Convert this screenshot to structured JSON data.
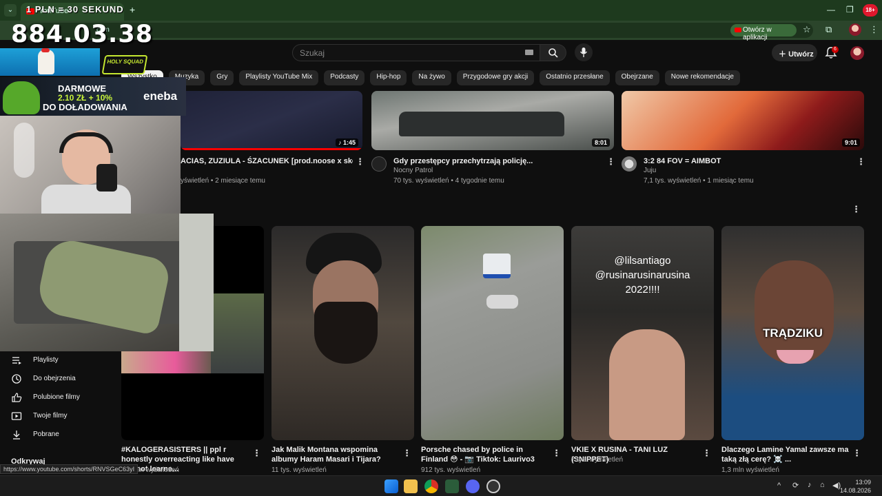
{
  "browser": {
    "tab_title": "YouTube",
    "new_tab": "+",
    "open_in_app": "Otwórz w aplikacji",
    "rec_badge": "18+",
    "url_visible": "com"
  },
  "overlay": {
    "timer_label": "1 PLN = 30 SEKUND",
    "timer": "884.03.38",
    "logo_text": "HOLY SQUAD",
    "promo_line1": "DARMOWE",
    "promo_line2": "2.10 ZŁ + 10%",
    "promo_line3": "DO DOŁADOWANIA",
    "promo_brand": "eneba"
  },
  "header": {
    "search_placeholder": "Szukaj",
    "create_label": "Utwórz",
    "notification_count": "6"
  },
  "chips": [
    "Wszystko",
    "Muzyka",
    "Gry",
    "Playlisty YouTube Mix",
    "Podcasty",
    "Hip-hop",
    "Na żywo",
    "Przygodowe gry akcji",
    "Ostatnio przesłane",
    "Obejrzane",
    "Nowe rekomendacje"
  ],
  "row1": [
    {
      "title": "ACIAS, ZUZIULA - ŚZACUNEK [prod.noose x skeety]",
      "channel": "",
      "meta": "yświetleń • 2 miesiące temu",
      "duration": "1:45"
    },
    {
      "title": "Gdy przestępcy przechytrzają policję...",
      "channel": "Nocny Patrol",
      "meta": "70 tys. wyświetleń • 4 tygodnie temu",
      "duration": "8:01"
    },
    {
      "title": "3:2 84 FOV = AIMBOT",
      "channel": "Juju",
      "meta": "7,1 tys. wyświetleń • 1 miesiąc temu",
      "duration": "9:01"
    }
  ],
  "shorts": [
    {
      "title": "#KALOGERASISTERS || ppl r honestly overreacting like have yall not learne...",
      "meta": "1,2 mln wyświetleń"
    },
    {
      "title": "Jak Malik Montana wspomina albumy Haram Masari i Tijara?",
      "meta": "11 tys. wyświetleń"
    },
    {
      "title": "Porsche chased by police in Finland 😳 - 📷 Tiktok: Laurivo3",
      "meta": "912 tys. wyświetleń"
    },
    {
      "title": "VKIE X RUSINA - TANI LUZ (SNIPPET)",
      "meta": "7 tys. wyświetleń"
    },
    {
      "title": "Dlaczego Lamine Yamal zawsze ma taką złą cerę? ☠️ ...",
      "meta": "1,3 mln wyświetleń"
    }
  ],
  "short_overlays": {
    "s4_line1": "@lilsantiago",
    "s4_line2": "@rusinarusinarusina",
    "s4_line3": "2022!!!!",
    "s5_caption": "TRĄDZIKU"
  },
  "sidebar": {
    "items": [
      {
        "label": "Playlisty",
        "icon": "playlist-icon"
      },
      {
        "label": "Do obejrzenia",
        "icon": "clock-icon"
      },
      {
        "label": "Polubione filmy",
        "icon": "thumbs-up-icon"
      },
      {
        "label": "Twoje filmy",
        "icon": "video-icon"
      },
      {
        "label": "Pobrane",
        "icon": "download-icon"
      }
    ],
    "section_title": "Odkrywaj"
  },
  "status_url": "https://www.youtube.com/shorts/RNVSGeC63yI",
  "taskbar": {
    "time": "13:09",
    "date": "14.08.2026"
  },
  "colors": {
    "bg": "#0f0f0f",
    "chrome_green": "#1e3a1e",
    "accent_red": "#ff0000",
    "promo_green": "#c7f23a"
  }
}
